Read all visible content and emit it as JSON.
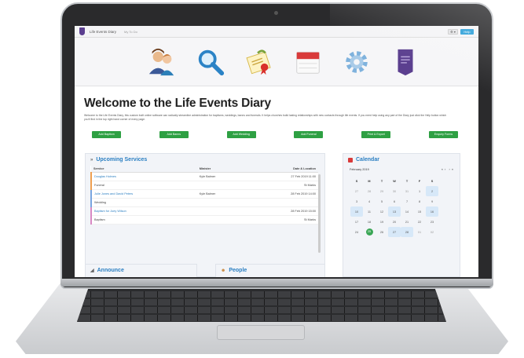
{
  "app": {
    "title": "Life Events Diary",
    "nav_todo": "My To Do",
    "settings_label": "⚙ ▾",
    "help_label": "Help"
  },
  "iconbar": [
    "people-icon",
    "search-icon",
    "certificate-icon",
    "calendar-icon",
    "gear-icon",
    "diary-book-icon"
  ],
  "page": {
    "heading": "Welcome to the Life Events Diary",
    "intro": "Welcome to the Life Events Diary, this custom built online software can radically streamline administration for baptisms, weddings, banns and funerals. It helps churches build lasting relationships with new contacts through life events. If you need help using any part of the Diary just click the Help button which you'll find in the top right hand corner of every page."
  },
  "actions": [
    "Add Baptism",
    "Add Banns",
    "Add Wedding",
    "Add Funeral",
    "Print & Export",
    "Enquiry Forms"
  ],
  "upcoming": {
    "title": "Upcoming Services",
    "columns": [
      "Service",
      "Minister",
      "Date & Location"
    ],
    "rows": [
      {
        "name": "Douglas Holmes",
        "minister": "Kyle Balmer",
        "date": "27 Feb 2019 11:00",
        "type": "Funeral",
        "location": "St Marks"
      },
      {
        "name": "Julie Jones and David Peters",
        "minister": "Kyle Balmer",
        "date": "28 Feb 2019 14:00",
        "type": "Wedding",
        "location": ""
      },
      {
        "name": "Baptism for Joey Wilson",
        "minister": "",
        "date": "28 Feb 2019 15:00",
        "type": "Baptism",
        "location": "St Marks"
      }
    ]
  },
  "calendar": {
    "title": "Calendar",
    "month": "February 2019",
    "nav": [
      "«",
      "‹",
      "›",
      "»"
    ],
    "days": [
      "S",
      "M",
      "T",
      "W",
      "T",
      "F",
      "S"
    ],
    "weeks": [
      [
        "27",
        "28",
        "29",
        "30",
        "31",
        "1",
        "2"
      ],
      [
        "3",
        "4",
        "5",
        "6",
        "7",
        "8",
        "9"
      ],
      [
        "10",
        "11",
        "12",
        "13",
        "14",
        "15",
        "16"
      ],
      [
        "17",
        "18",
        "19",
        "20",
        "21",
        "22",
        "23"
      ],
      [
        "24",
        "25",
        "26",
        "27",
        "28",
        "01",
        "02"
      ]
    ]
  },
  "announce": {
    "title": "Announce"
  },
  "people": {
    "title": "People"
  },
  "colors": {
    "accent": "#2b7fc2",
    "button_green": "#2ea043",
    "brand_purple": "#5b3f8f",
    "today": "#3aa655"
  }
}
